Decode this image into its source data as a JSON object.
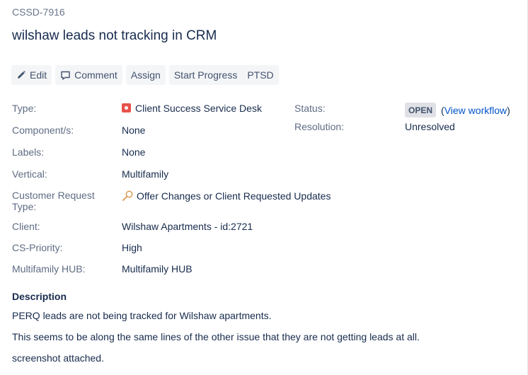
{
  "issue": {
    "key": "CSSD-7916",
    "summary": "wilshaw leads not tracking in CRM"
  },
  "toolbar": {
    "edit_label": "Edit",
    "comment_label": "Comment",
    "assign_label": "Assign",
    "start_progress_label": "Start Progress",
    "ptsd_label": "PTSD",
    "edit_icon": "pencil-icon",
    "comment_icon": "comment-icon"
  },
  "details": {
    "type": {
      "label": "Type:",
      "value": "Client Success Service Desk",
      "icon": "service-desk-icon",
      "icon_color": "#e5534b"
    },
    "components": {
      "label": "Component/s:",
      "value": "None"
    },
    "labels": {
      "label": "Labels:",
      "value": "None"
    },
    "vertical": {
      "label": "Vertical:",
      "value": "Multifamily"
    },
    "request_type": {
      "label_line1": "Customer Request",
      "label_line2": "Type:",
      "value": "Offer Changes or Client Requested Updates",
      "icon": "request-type-icon"
    },
    "client": {
      "label": "Client:",
      "value": "Wilshaw Apartments - id:2721"
    },
    "cs_priority": {
      "label": "CS-Priority:",
      "value": "High"
    },
    "hub": {
      "label": "Multifamily HUB:",
      "value": "Multifamily HUB"
    },
    "status": {
      "label": "Status:",
      "value": "OPEN",
      "link_open": "(",
      "link": "View workflow",
      "link_close": ")"
    },
    "resolution": {
      "label": "Resolution:",
      "value": "Unresolved"
    }
  },
  "description": {
    "heading": "Description",
    "lines": [
      "PERQ leads are not being tracked for Wilshaw apartments.",
      "This seems to be along the same lines of the other issue that they are not getting leads at all.",
      "screenshot attached."
    ]
  },
  "colors": {
    "link": "#0052cc",
    "label": "#5e6c84",
    "text": "#172b4d",
    "button_bg": "#f4f5f7"
  }
}
